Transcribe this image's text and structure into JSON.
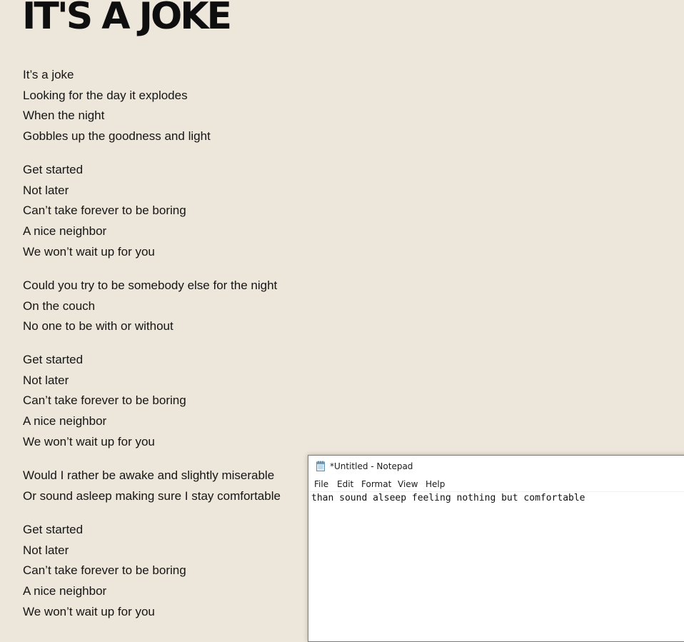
{
  "song": {
    "title": "IT'S A JOKE",
    "stanzas": [
      {
        "lines": [
          "It’s a joke",
          "Looking for the day it explodes",
          "When the night",
          "Gobbles up the goodness and light"
        ]
      },
      {
        "lines": [
          "Get started",
          "Not later",
          "Can’t take forever to be boring",
          "A nice neighbor",
          "We won’t wait up for you"
        ]
      },
      {
        "lines": [
          "Could you try to be somebody else for the night",
          "On the couch",
          "No one to be with or without"
        ]
      },
      {
        "lines": [
          "Get started",
          "Not later",
          "Can’t take forever to be boring",
          "A nice neighbor",
          "We won’t wait up for you"
        ]
      },
      {
        "lines": [
          "Would I rather be awake and slightly miserable",
          "Or sound asleep making sure I stay comfortable"
        ]
      },
      {
        "lines": [
          "Get started",
          "Not later",
          "Can’t take forever to be boring",
          "A nice neighbor",
          "We won’t wait up for you"
        ]
      }
    ]
  },
  "notepad": {
    "title": "*Untitled - Notepad",
    "icon": "notepad-icon",
    "menu": [
      "File",
      "Edit",
      "Format",
      "View",
      "Help"
    ],
    "content": "than sound alseep feeling nothing but comfortable"
  },
  "colors": {
    "page_background": "#ede6da",
    "text": "#151515",
    "notepad_background": "#ffffff"
  }
}
